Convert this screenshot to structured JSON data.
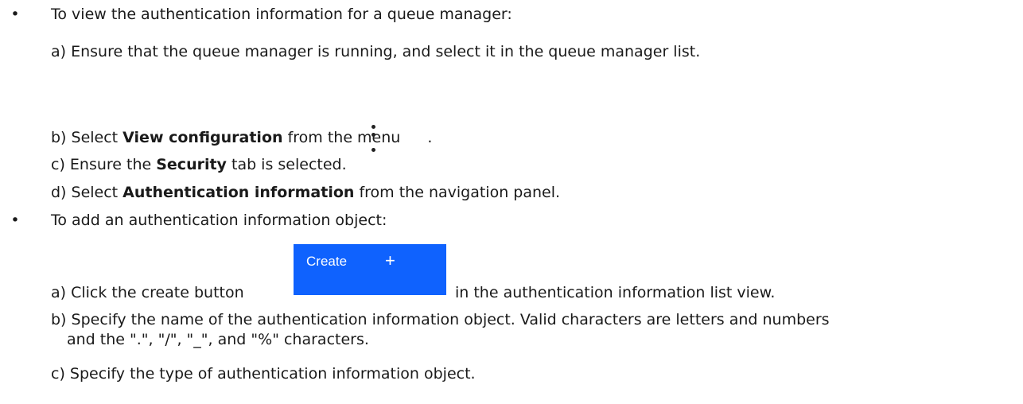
{
  "bullets": [
    {
      "text": "To view the authentication information for a queue manager:",
      "steps": {
        "a": {
          "prefix": "a) Ensure that the queue manager is running, and select it in the queue manager list."
        },
        "b": {
          "prefix": "b) Select ",
          "bold": "View configuration",
          "suffix": " from the menu",
          "end": "."
        },
        "c": {
          "prefix": "c) Ensure the ",
          "bold": "Security",
          "suffix": " tab is selected."
        },
        "d": {
          "prefix": "d) Select ",
          "bold": "Authentication information",
          "suffix": " from the navigation panel."
        }
      }
    },
    {
      "text": "To add an authentication information object:",
      "steps": {
        "a": {
          "prefix": "a) Click the create button",
          "suffix": "in the authentication information list view."
        },
        "b": {
          "line1": "b) Specify the name of the authentication information object. Valid characters are letters and numbers",
          "line2": "and the \".\", \"/\", \"_\", and \"%\" characters."
        },
        "c": {
          "prefix": "c) Specify the type of authentication information object."
        }
      }
    }
  ],
  "bullet_glyph": "•",
  "menu_icon": "overflow-menu-vertical-icon",
  "create_button": {
    "label": "Create",
    "plus": "+",
    "color": "#0f62fe",
    "icon": "plus-icon"
  }
}
